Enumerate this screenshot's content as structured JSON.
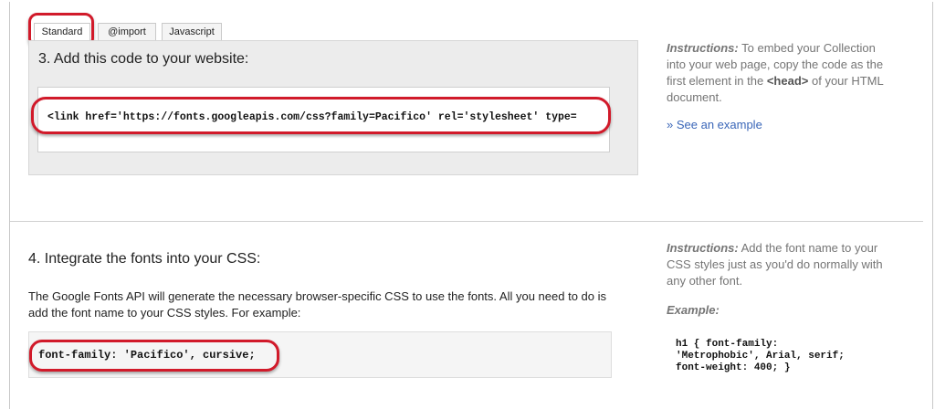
{
  "tabs": [
    {
      "label": "Standard"
    },
    {
      "label": "@import"
    },
    {
      "label": "Javascript"
    }
  ],
  "step3": {
    "title": "3. Add this code to your website:",
    "code": "<link href='https://fonts.googleapis.com/css?family=Pacifico' rel='stylesheet' type="
  },
  "instructions3": {
    "label": "Instructions:",
    "text_before": "To embed your Collection into your web page, copy the code as the first element in the",
    "head_tag": "<head>",
    "text_after": "of your HTML document."
  },
  "see_example": "» See an example",
  "step4": {
    "title": "4. Integrate the fonts into your CSS:",
    "paragraph": "The Google Fonts API will generate the necessary browser-specific CSS to use the fonts. All you need to do is add the font name to your CSS styles. For example:",
    "code": "font-family: 'Pacifico', cursive;"
  },
  "instructions4": {
    "label": "Instructions:",
    "text": "Add the font name to your CSS styles just as you'd do normally with any other font.",
    "example_label": "Example:",
    "example_code": "h1 { font-family:\n'Metrophobic', Arial, serif;\nfont-weight: 400; }"
  },
  "colors": {
    "highlight_ring": "#d11a2a",
    "link": "#3a66b8",
    "instruction_text": "#757575"
  }
}
